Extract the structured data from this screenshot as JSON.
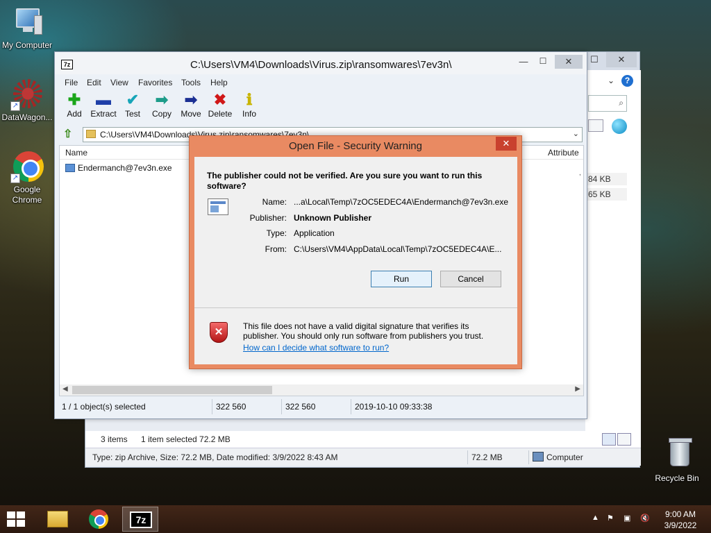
{
  "desktop": {
    "icons": [
      {
        "label": "My Computer"
      },
      {
        "label": "DataWagon..."
      },
      {
        "label": "Google Chrome"
      },
      {
        "label": "Recycle Bin"
      }
    ]
  },
  "explorer": {
    "items_count": "3 items",
    "selected": "1 item selected  72.2 MB",
    "status_left": "Type: zip Archive, Size: 72.2 MB, Date modified: 3/9/2022 8:43 AM",
    "status_size": "72.2 MB",
    "status_location": "Computer",
    "sizes": [
      "84 KB",
      "65 KB"
    ]
  },
  "sevenzip": {
    "title": "C:\\Users\\VM4\\Downloads\\Virus.zip\\ransomwares\\7ev3n\\",
    "app_icon": "7z",
    "menu": [
      "File",
      "Edit",
      "View",
      "Favorites",
      "Tools",
      "Help"
    ],
    "toolbar": [
      {
        "label": "Add",
        "icon": "plus-icon",
        "color": "#1aa51a"
      },
      {
        "label": "Extract",
        "icon": "minus-icon",
        "color": "#1f3fa8"
      },
      {
        "label": "Test",
        "icon": "check-icon",
        "color": "#17a5b8"
      },
      {
        "label": "Copy",
        "icon": "double-arrow-icon",
        "color": "#1d9c8a"
      },
      {
        "label": "Move",
        "icon": "arrow-right-icon",
        "color": "#1b2f93"
      },
      {
        "label": "Delete",
        "icon": "x-icon",
        "color": "#d01818"
      },
      {
        "label": "Info",
        "icon": "info-icon",
        "color": "#c8b400"
      }
    ],
    "address": "C:\\Users\\VM4\\Downloads\\Virus.zip\\ransomwares\\7ev3n\\",
    "columns": {
      "name": "Name",
      "attributes": "Attribute"
    },
    "files": [
      {
        "name": "Endermanch@7ev3n.exe"
      }
    ],
    "status": {
      "selected": "1 / 1 object(s) selected",
      "size": "322 560",
      "packed": "322 560",
      "modified": "2019-10-10 09:33:38"
    }
  },
  "dialog": {
    "title": "Open File - Security Warning",
    "question": "The publisher could not be verified.  Are you sure you want to run this software?",
    "fields": [
      {
        "label": "Name:",
        "value": "...a\\Local\\Temp\\7zOC5EDEC4A\\Endermanch@7ev3n.exe",
        "bold": false
      },
      {
        "label": "Publisher:",
        "value": "Unknown Publisher",
        "bold": true
      },
      {
        "label": "Type:",
        "value": "Application",
        "bold": false
      },
      {
        "label": "From:",
        "value": "C:\\Users\\VM4\\AppData\\Local\\Temp\\7zOC5EDEC4A\\E...",
        "bold": false
      }
    ],
    "run_label": "Run",
    "cancel_label": "Cancel",
    "warning": "This file does not have a valid digital signature that verifies its publisher.  You should only run software from publishers you trust.",
    "link": "How can I decide what software to run?"
  },
  "taskbar": {
    "time": "9:00 AM",
    "date": "3/9/2022"
  }
}
